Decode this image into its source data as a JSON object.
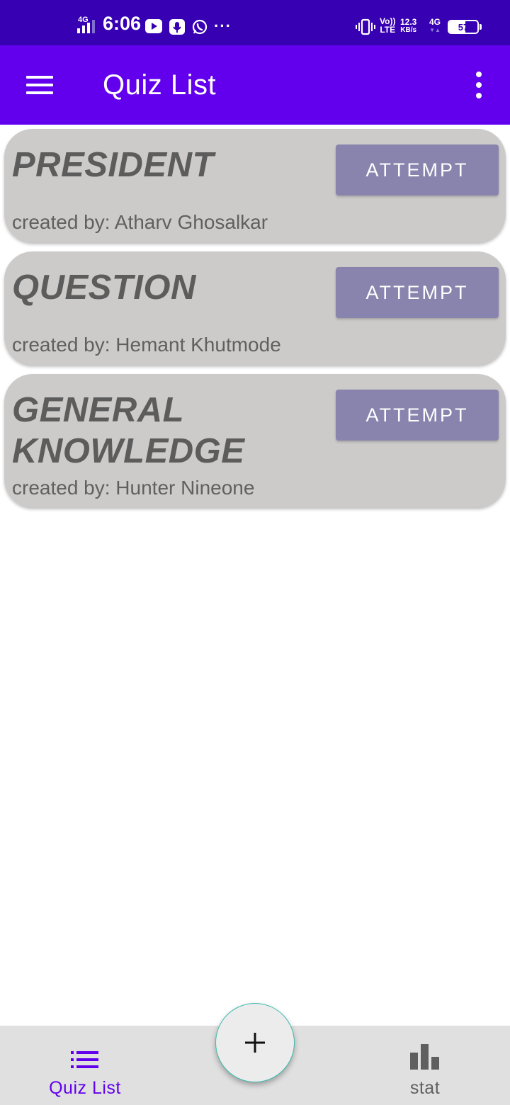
{
  "status_bar": {
    "network_left": "4G",
    "time": "6:06",
    "more": "···",
    "volte_top": "Vo))",
    "volte_bottom": "LTE",
    "speed_value": "12.3",
    "speed_unit": "KB/s",
    "network_right": "4G",
    "battery": "57",
    "battery_level_percent": 57,
    "icons": [
      "signal-icon",
      "youtube-icon",
      "voice-recorder-icon",
      "whatsapp-icon",
      "vibrate-icon",
      "battery-icon"
    ]
  },
  "app_bar": {
    "title": "Quiz List",
    "icons": [
      "hamburger-menu-icon",
      "overflow-menu-icon"
    ]
  },
  "quizzes": [
    {
      "title": "PRESIDENT",
      "creator": "created by: Atharv Ghosalkar",
      "button": "ATTEMPT"
    },
    {
      "title": "QUESTION",
      "creator": "created by: Hemant Khutmode",
      "button": "ATTEMPT"
    },
    {
      "title": "GENERAL KNOWLEDGE",
      "creator": "created by: Hunter Nineone",
      "button": "ATTEMPT"
    }
  ],
  "fab": {
    "icon": "plus-icon"
  },
  "bottom_nav": {
    "items": [
      {
        "label": "Quiz List",
        "icon": "list-icon",
        "active": true
      },
      {
        "label": "stat",
        "icon": "bar-chart-icon",
        "active": false
      }
    ]
  },
  "colors": {
    "status_bar": "#3700b3",
    "app_bar": "#6200ee",
    "card": "#cdcbca",
    "attempt_button": "#8984ae",
    "nav_active": "#6200ee",
    "nav_inactive": "#5f5f5f",
    "bottom_nav_bg": "#e0e0e0"
  }
}
